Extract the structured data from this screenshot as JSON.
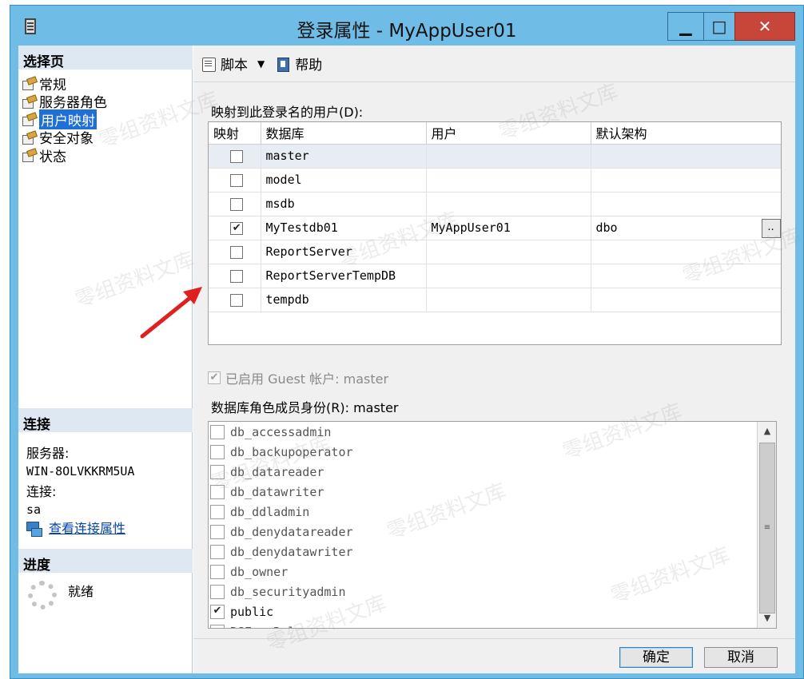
{
  "window": {
    "title": "登录属性 - MyAppUser01",
    "minimize_glyph": "▁",
    "maximize_glyph": "□",
    "close_glyph": "✕"
  },
  "left": {
    "select_page_header": "选择页",
    "nav_items": [
      {
        "label": "常规",
        "selected": false
      },
      {
        "label": "服务器角色",
        "selected": false
      },
      {
        "label": "用户映射",
        "selected": true
      },
      {
        "label": "安全对象",
        "selected": false
      },
      {
        "label": "状态",
        "selected": false
      }
    ],
    "connection_header": "连接",
    "server_label": "服务器:",
    "server_value": "WIN-8OLVKKRM5UA",
    "connection_label": "连接:",
    "connection_value": "sa",
    "view_connection_link": "查看连接属性",
    "progress_header": "进度",
    "progress_status": "就绪"
  },
  "toolbar": {
    "script_label": "脚本",
    "help_label": "帮助"
  },
  "mapping": {
    "label": "映射到此登录名的用户(D):",
    "columns": [
      "映射",
      "数据库",
      "用户",
      "默认架构"
    ],
    "rows": [
      {
        "mapped": false,
        "database": "master",
        "user": "",
        "schema": ""
      },
      {
        "mapped": false,
        "database": "model",
        "user": "",
        "schema": ""
      },
      {
        "mapped": false,
        "database": "msdb",
        "user": "",
        "schema": ""
      },
      {
        "mapped": true,
        "database": "MyTestdb01",
        "user": "MyAppUser01",
        "schema": "dbo"
      },
      {
        "mapped": false,
        "database": "ReportServer",
        "user": "",
        "schema": ""
      },
      {
        "mapped": false,
        "database": "ReportServerTempDB",
        "user": "",
        "schema": ""
      },
      {
        "mapped": false,
        "database": "tempdb",
        "user": "",
        "schema": ""
      }
    ],
    "ellipsis": ".."
  },
  "guest": {
    "label": "已启用 Guest 帐户: master",
    "checked": true
  },
  "roles": {
    "label": "数据库角色成员身份(R): master",
    "items": [
      {
        "name": "db_accessadmin",
        "checked": false
      },
      {
        "name": "db_backupoperator",
        "checked": false
      },
      {
        "name": "db_datareader",
        "checked": false
      },
      {
        "name": "db_datawriter",
        "checked": false
      },
      {
        "name": "db_ddladmin",
        "checked": false
      },
      {
        "name": "db_denydatareader",
        "checked": false
      },
      {
        "name": "db_denydatawriter",
        "checked": false
      },
      {
        "name": "db_owner",
        "checked": false
      },
      {
        "name": "db_securityadmin",
        "checked": false
      },
      {
        "name": "public",
        "checked": true
      },
      {
        "name": "RSExecRole",
        "checked": false
      }
    ]
  },
  "buttons": {
    "ok": "确定",
    "cancel": "取消"
  },
  "watermark_text": "零组资料文库",
  "colors": {
    "titlebar": "#6fbde6",
    "close_button": "#c8453a",
    "selection": "#1f6fd6",
    "arrow": "#e02020"
  }
}
